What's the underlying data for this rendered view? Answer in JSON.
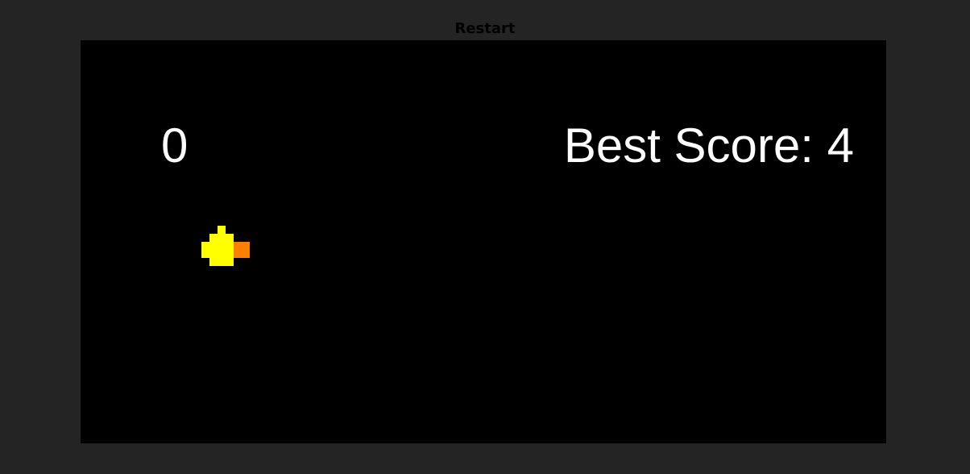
{
  "toolbar": {
    "restart_label": "Restart"
  },
  "game": {
    "score": "0",
    "best_score_label": "Best Score:",
    "best_score_value": "4",
    "colors": {
      "background": "#000000",
      "page_background": "#242424",
      "text": "#ffffff",
      "bird_body": "#ffff00",
      "bird_beak": "#ff8000"
    },
    "player": {
      "icon": "pixel-bird-icon"
    }
  }
}
